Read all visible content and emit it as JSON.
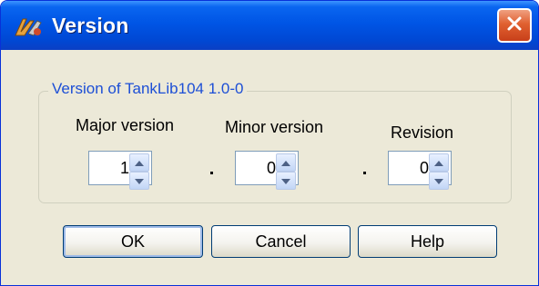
{
  "window": {
    "title": "Version",
    "app_icon": "app-logo-icon",
    "close_icon": "close-icon"
  },
  "frame": {
    "legend": "Version of TankLib104 1.0-0"
  },
  "fields": {
    "major": {
      "label": "Major version",
      "value": "1"
    },
    "minor": {
      "label": "Minor version",
      "value": "0"
    },
    "revision": {
      "label": "Revision",
      "value": "0"
    }
  },
  "buttons": {
    "ok": "OK",
    "cancel": "Cancel",
    "help": "Help"
  },
  "colors": {
    "title_bar": "#0055e5",
    "close": "#e06030",
    "frame_legend": "#1d4fd6",
    "dialog_bg": "#ece9d8"
  }
}
